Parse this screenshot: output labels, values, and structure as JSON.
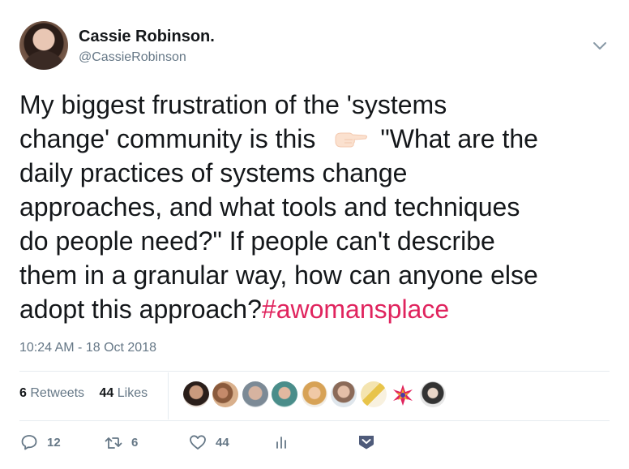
{
  "user": {
    "name": "Cassie Robinson.",
    "handle": "@CassieRobinson"
  },
  "tweet": {
    "lines": [
      "My biggest frustration of the 'systems",
      "change' community is this",
      "\"What are the",
      "daily practices of systems change",
      "approaches, and what tools and techniques",
      "do people need?\" If people can't describe",
      "them in a granular way, how can anyone else",
      "adopt this approach?"
    ],
    "hashtag": "#awomansplace",
    "emoji": "backhand-index-pointing-right"
  },
  "timestamp": "10:24 AM - 18 Oct 2018",
  "stats": {
    "retweets_count": "6",
    "retweets_label": "Retweets",
    "likes_count": "44",
    "likes_label": "Likes"
  },
  "liker_avatars": 9,
  "actions": {
    "replies": "12",
    "retweets": "6",
    "likes": "44"
  },
  "colors": {
    "text": "#14171a",
    "secondary": "#657786",
    "hashtag": "#e0245e",
    "separator": "#e6ecf0",
    "brand_icon": "#4f5b7a"
  },
  "icons": [
    "chevron-down-icon",
    "reply-icon",
    "retweet-icon",
    "like-icon",
    "analytics-icon",
    "dm-heart-icon",
    "pointing-right-emoji"
  ]
}
